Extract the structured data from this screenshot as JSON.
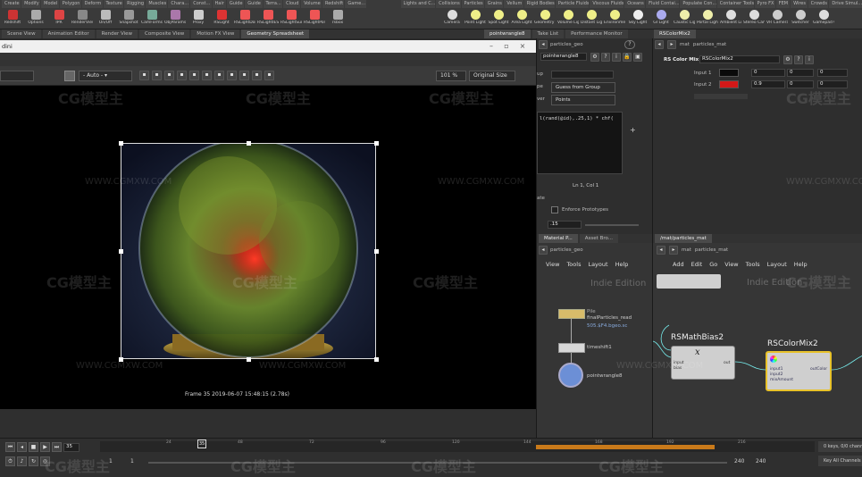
{
  "shelf": {
    "tabs": [
      "Create",
      "Modify",
      "Model",
      "Polygon",
      "Deform",
      "Texture",
      "Rigging",
      "Muscles",
      "Chara...",
      "Const...",
      "Hair",
      "Guide",
      "Guide",
      "Terra...",
      "Cloud",
      "Volume",
      "Redshift",
      "Game..."
    ],
    "tabs_right": [
      "Lights and C...",
      "Collisions",
      "Particles",
      "Grains",
      "Vellum",
      "Rigid Bodies",
      "Particle Fluids",
      "Viscous Fluids",
      "Oceans",
      "Fluid Contai...",
      "Populate Con...",
      "Container Tools",
      "Pyro FX",
      "FEM",
      "Wires",
      "Crowds",
      "Drive Simul..."
    ],
    "tools": [
      "Redshift",
      "Options",
      "IPR",
      "RenderView",
      "On/Off",
      "Snapshot",
      "CamForms",
      "ObjParams",
      "Proxy",
      "RSLight",
      "RSLightDome",
      "RSLightIES",
      "RSLightSun",
      "RSLightPortal",
      "rsbox"
    ],
    "tools_right": [
      "Camera",
      "Point Light",
      "Spot Light",
      "Area Light",
      "Geometry Light",
      "Volume Light",
      "Distant Light",
      "Environment Light",
      "Sky Light",
      "GI Light",
      "Caustic Light",
      "Portal Light",
      "Ambient Light",
      "Stereo Camera",
      "VR Camera",
      "Switcher",
      "Gamepad Camera"
    ]
  },
  "pane_tabs": {
    "left": [
      "Scene View",
      "Animation Editor",
      "Render View",
      "Composite View",
      "Motion FX View",
      "Geometry Spreadsheet"
    ],
    "mid": [
      "pointwrangle8",
      "Take List",
      "Performance Monitor"
    ],
    "right": [
      "RSColorMix2"
    ]
  },
  "viewport": {
    "title_suffix": "dini",
    "auto_label": "- Auto -",
    "zoom": "101 %",
    "size_mode": "Original Size",
    "frame_info": "Frame  35   2019-06-07  15:48:15  (2.78s)"
  },
  "param_pane": {
    "path": "particles_geo",
    "node_type_name": "pointwrangle8",
    "group_type_label": "Guess from Group",
    "over_label": "Points",
    "code": "l(rand(@id),.25,1) * chf(",
    "cursor_pos": "Ln 1, Col 1",
    "enforce_prototypes": "Enforce Prototypes",
    "value": ".15",
    "row_labels": [
      "up",
      "pe",
      "ver",
      "ate"
    ]
  },
  "rs_pane": {
    "path_a": "mat",
    "path_b": "particles_mat",
    "node_type": "RS Color Mix",
    "node_name": "RSColorMix2",
    "input1_label": "Input 1",
    "input2_label": "Input 2",
    "input1": [
      "0",
      "0",
      "0"
    ],
    "input2": [
      "0.9",
      "0",
      "0"
    ],
    "input1_color": "#0a0a0a",
    "input2_color": "#d21818"
  },
  "network_left": {
    "tabs": [
      "Material P...",
      "Asset Bro..."
    ],
    "path": "particles_geo",
    "menu": [
      "View",
      "Tools",
      "Layout",
      "Help"
    ],
    "edition": "Indie Edition",
    "nodes": [
      {
        "name": "finalParticles_read",
        "sub": "Pile",
        "info": "505.$F4.bgeo.sc"
      },
      {
        "name": "timeshift1",
        "sub": "",
        "info": ""
      },
      {
        "name": "pointwrangle8",
        "sub": "",
        "info": ""
      }
    ]
  },
  "network_right": {
    "tab": "/mat/particles_mat",
    "path_a": "mat",
    "path_b": "particles_mat",
    "menu": [
      "Add",
      "Edit",
      "Go",
      "View",
      "Tools",
      "Layout",
      "Help"
    ],
    "edition": "Indie Edition",
    "node_a": {
      "title": "RSMathBias2",
      "ports_in": [
        "input",
        "bias"
      ],
      "port_out": "out"
    },
    "node_b": {
      "title": "RSColorMix2",
      "ports_in": [
        "input1",
        "input2",
        "mixAmount"
      ],
      "port_out": "outColor"
    }
  },
  "timeline": {
    "current_frame": "35",
    "start": "1",
    "start2": "1",
    "end": "240",
    "end2": "240",
    "ticks": [
      "24",
      "48",
      "72",
      "96",
      "120",
      "144",
      "168",
      "192",
      "216"
    ],
    "keys_label": "0 keys, 0/0 chann",
    "key_all": "Key All Channels"
  },
  "watermarks": [
    "CG模型主",
    "WWW.CGMXW.COM"
  ],
  "colors": {
    "accent_orange": "#c97a1a",
    "selected_node": "#e8c22a"
  }
}
